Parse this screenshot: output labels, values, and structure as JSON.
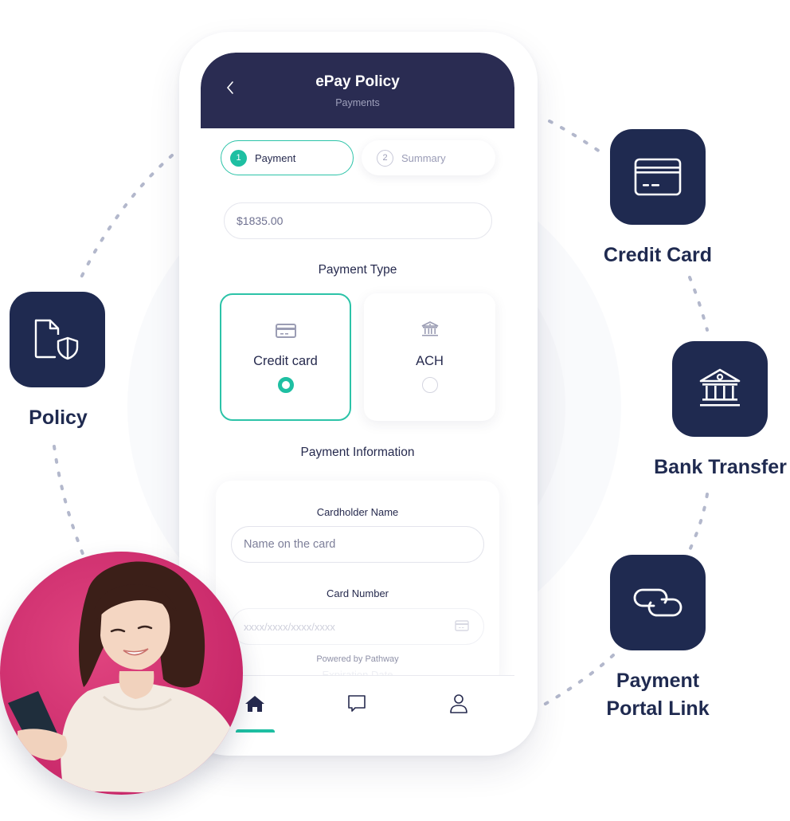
{
  "app": {
    "title": "ePay Policy",
    "subtitle": "Payments",
    "back_icon": "chevron-left-icon"
  },
  "steps": [
    {
      "number": "1",
      "label": "Payment",
      "active": true
    },
    {
      "number": "2",
      "label": "Summary",
      "active": false
    }
  ],
  "amount": {
    "value": "$1835.00"
  },
  "payment_type": {
    "title": "Payment Type",
    "options": [
      {
        "label": "Credit card",
        "icon": "credit-card-icon",
        "selected": true
      },
      {
        "label": "ACH",
        "icon": "bank-icon",
        "selected": false
      }
    ]
  },
  "payment_info": {
    "title": "Payment Information",
    "cardholder_label": "Cardholder Name",
    "cardholder_placeholder": "Name on the card",
    "card_number_label": "Card Number",
    "card_number_placeholder": "xxxx/xxxx/xxxx/xxxx",
    "powered_by": "Powered by Pathway",
    "expiration_label": "Expiration Date"
  },
  "bottom_nav": {
    "items": [
      {
        "name": "home",
        "icon": "home-icon",
        "active": true
      },
      {
        "name": "messages",
        "icon": "chat-icon",
        "active": false
      },
      {
        "name": "profile",
        "icon": "user-icon",
        "active": false
      }
    ]
  },
  "features": [
    {
      "label": "Policy",
      "icon": "policy-shield-icon"
    },
    {
      "label": "Credit Card",
      "icon": "credit-card-icon"
    },
    {
      "label": "Bank Transfer",
      "icon": "bank-icon"
    },
    {
      "label": "Payment Portal Link",
      "label_line1": "Payment",
      "label_line2": "Portal Link",
      "icon": "link-icon"
    }
  ],
  "colors": {
    "navy": "#2a2c52",
    "tile_navy": "#1f2a50",
    "accent_teal": "#1ebfa2",
    "photo_bg": "#d2306f",
    "dots": "#b3b8cc"
  }
}
